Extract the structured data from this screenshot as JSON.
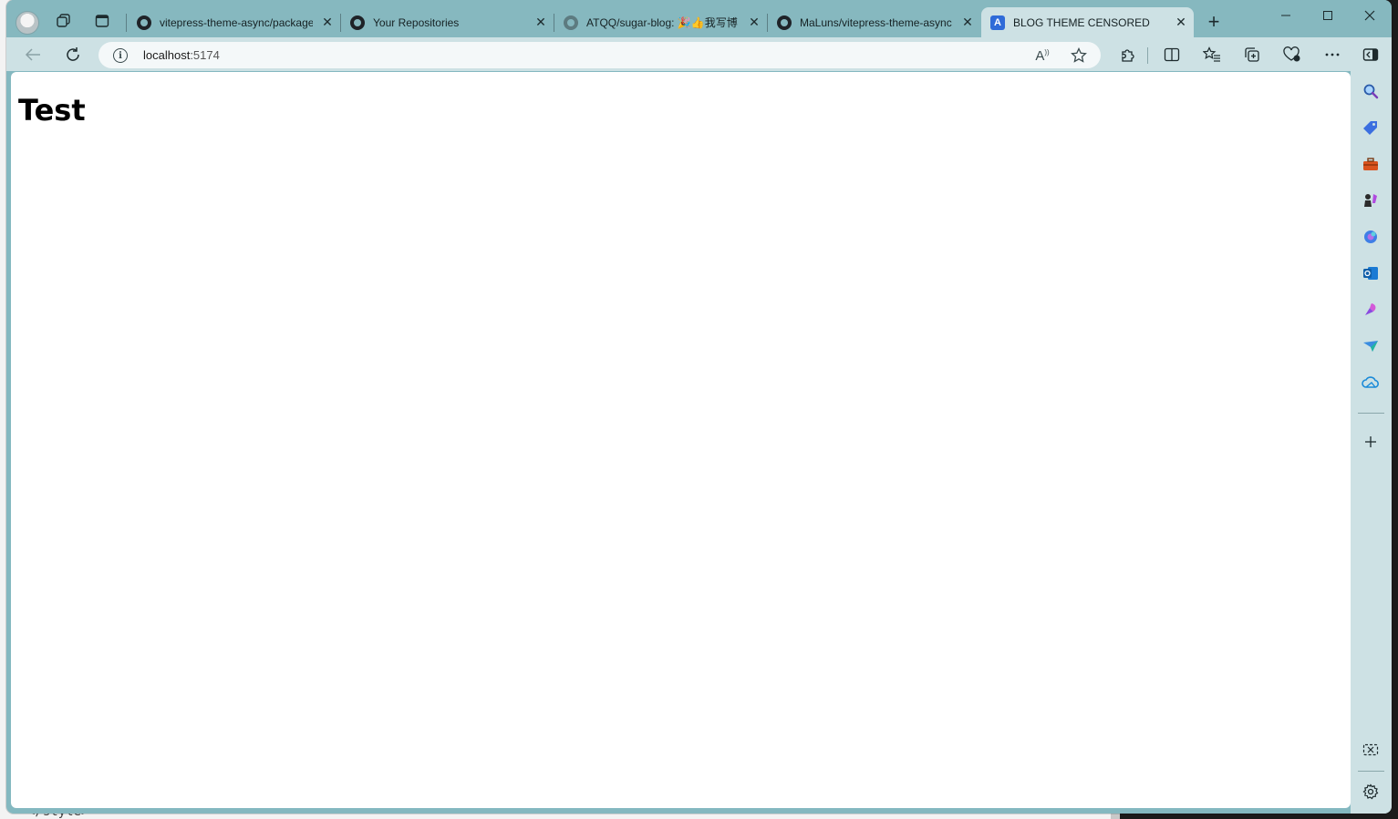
{
  "browser": {
    "tabs": [
      {
        "title": "vitepress-theme-async/package",
        "favicon": "github-icon"
      },
      {
        "title": "Your Repositories",
        "favicon": "github-icon"
      },
      {
        "title": "ATQQ/sugar-blog: 🎉👍我写博",
        "favicon": "github-icon-faded"
      },
      {
        "title": "MaLuns/vitepress-theme-async",
        "favicon": "github-icon"
      },
      {
        "title": "BLOG THEME CENSORED",
        "favicon": "a-logo",
        "active": true
      }
    ],
    "close_glyph": "✕",
    "new_tab_glyph": "+",
    "address": {
      "host": "localhost",
      "port": ":5174"
    },
    "read_aloud_glyph": "A",
    "favicon_letter": "A"
  },
  "page": {
    "heading": "Test"
  },
  "background": {
    "code_text": "</style>"
  },
  "colors": {
    "tabbar": "#86b8bf",
    "toolbar": "#cde1e4",
    "active_tab": "#cde1e4",
    "content_bg": "#ffffff"
  },
  "sidebar": {
    "icons": [
      "search-icon",
      "shopping-tag-icon",
      "toolbox-icon",
      "games-icon",
      "copilot-icon",
      "outlook-icon",
      "designer-icon",
      "send-icon",
      "cloud-icon",
      "add-icon",
      "screenshot-icon",
      "settings-icon"
    ]
  }
}
